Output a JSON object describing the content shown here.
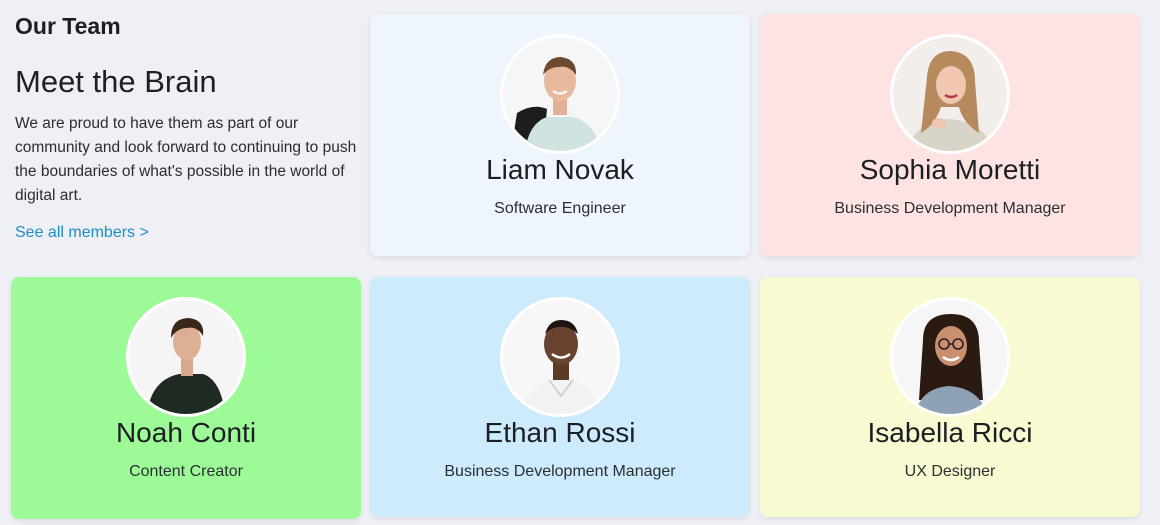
{
  "section": {
    "eyebrow": "Our Team",
    "headline": "Meet the Brain",
    "blurb": "We are proud to have them as part of our community and look forward to continuing to push the boundaries of what's possible in the world of digital art.",
    "link_label": "See all members >",
    "link_color": "#1a8fc6"
  },
  "members": [
    {
      "name": "Liam Novak",
      "role": "Software Engineer",
      "card_color": "#eef5fd",
      "avatar_icon": "person-photo-icon"
    },
    {
      "name": "Sophia Moretti",
      "role": "Business Development Manager",
      "card_color": "#fde4e3",
      "avatar_icon": "person-photo-icon"
    },
    {
      "name": "Noah Conti",
      "role": "Content Creator",
      "card_color": "#9dfb97",
      "avatar_icon": "person-photo-icon"
    },
    {
      "name": "Ethan Rossi",
      "role": "Business Development Manager",
      "card_color": "#cdebfc",
      "avatar_icon": "person-photo-icon"
    },
    {
      "name": "Isabella Ricci",
      "role": "UX Designer",
      "card_color": "#f9fad2",
      "avatar_icon": "person-photo-icon"
    }
  ]
}
